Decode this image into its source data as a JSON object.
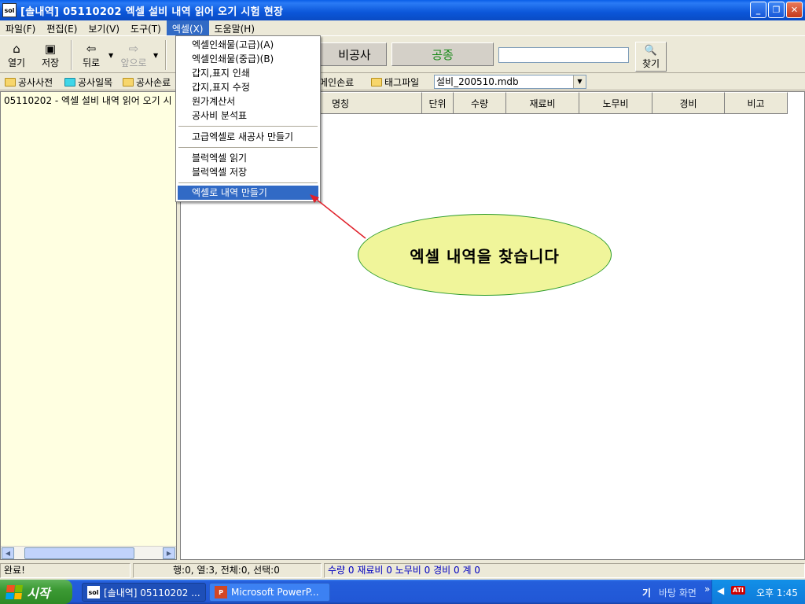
{
  "window": {
    "title": "[솔내역] 05110202 엑셀 설비 내역 읽어 오기 시험 현장",
    "app_icon_text": "sol"
  },
  "menubar": [
    {
      "label": "파일(F)"
    },
    {
      "label": "편집(E)"
    },
    {
      "label": "보기(V)"
    },
    {
      "label": "도구(T)"
    },
    {
      "label": "엑셀(X)"
    },
    {
      "label": "도움말(H)"
    }
  ],
  "toolbar": {
    "open_label": "열기",
    "save_label": "저장",
    "back_label": "뒤로",
    "forward_label": "앞으로",
    "category_label": "비공사",
    "type_label": "공종",
    "search_value": "",
    "find_label": "찾기"
  },
  "bar2": {
    "items": [
      "공사사전",
      "공사일목",
      "공사손료",
      "메인손료",
      "태그파일"
    ],
    "db_file": "설비_200510.mdb"
  },
  "excel_menu": {
    "items": [
      "엑셀인쇄물(고급)(A)",
      "엑셀인쇄물(중급)(B)",
      "갑지,표지 인쇄",
      "갑지,표지 수정",
      "원가계산서",
      "공사비 분석표",
      "고급엑셀로 새공사 만들기",
      "블럭엑셀 읽기",
      "블럭엑셀 저장",
      "엑셀로 내역 만들기"
    ]
  },
  "tree": {
    "root_label": "05110202 - 엑셀 설비 내역 읽어 오기 시"
  },
  "grid": {
    "columns": [
      "명칭",
      "단위",
      "수량",
      "재료비",
      "노무비",
      "경비",
      "비고"
    ]
  },
  "callout": {
    "text": "엑셀 내역을 찾습니다"
  },
  "statusbar": {
    "status": "완료!",
    "position": "행:0, 열:3, 전체:0, 선택:0",
    "totals": "수량 0   재료비 0   노무비 0   경비 0   계 0"
  },
  "taskbar": {
    "start_label": "시작",
    "tasks": [
      "[솔내역] 05110202 ...",
      "Microsoft PowerP..."
    ],
    "ime": "기",
    "desktop_label": "바탕 화면",
    "clock": "오후 1:45"
  },
  "colors": {
    "title_bar": "#0a5ee8",
    "menu_highlight": "#316ac5",
    "callout_fill": "#f0f59a",
    "arrow": "#e0202a",
    "type_label_green": "#1a8a1a"
  }
}
